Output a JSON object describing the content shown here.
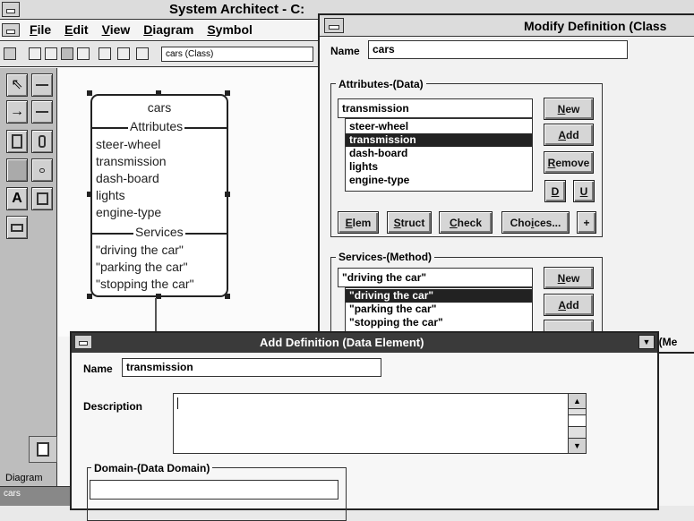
{
  "main_window": {
    "title": "System Architect - C:",
    "menu": [
      {
        "ul": "F",
        "rest": "ile"
      },
      {
        "ul": "E",
        "rest": "dit"
      },
      {
        "ul": "V",
        "rest": "iew"
      },
      {
        "ul": "D",
        "rest": "iagram"
      },
      {
        "ul": "S",
        "rest": "ymbol"
      }
    ],
    "toolbar_combo": "cars (Class)",
    "diagram_icon_label": "Diagram",
    "status_text": "cars"
  },
  "class_symbol": {
    "name": "cars",
    "attributes_header": "Attributes",
    "attributes": [
      "steer-wheel",
      "transmission",
      "dash-board",
      "lights",
      "engine-type"
    ],
    "services_header": "Services",
    "services": [
      "\"driving the car\"",
      "\"parking the car\"",
      "\"stopping the car\""
    ]
  },
  "modify_dialog": {
    "title": "Modify  Definition (Class",
    "name_label": "Name",
    "name_value": "cars",
    "attributes_group": "Attributes-(Data)",
    "attributes_input": "transmission",
    "attributes_list": [
      "steer-wheel",
      "transmission",
      "dash-board",
      "lights",
      "engine-type"
    ],
    "attributes_selected": 1,
    "btn_new": {
      "ul": "N",
      "rest": "ew"
    },
    "btn_add": {
      "ul": "A",
      "rest": "dd"
    },
    "btn_remove": {
      "ul": "R",
      "rest": "emove"
    },
    "btn_d": "D",
    "btn_u": "U",
    "btn_elem": {
      "ul": "E",
      "rest": "lem"
    },
    "btn_struct": {
      "ul": "S",
      "rest": "truct"
    },
    "btn_check": {
      "ul": "C",
      "rest": "heck"
    },
    "btn_choices_a": "Cho",
    "btn_choices_ul": "i",
    "btn_choices_b": "ces...",
    "btn_plus": "+",
    "services_group": "Services-(Method)",
    "services_input": "\"driving the car\"",
    "services_list": [
      "\"driving the car\"",
      "\"parking the car\"",
      "\"stopping the car\""
    ],
    "services_selected": 0,
    "services_new": {
      "ul": "N",
      "rest": "ew"
    },
    "services_add": {
      "ul": "A",
      "rest": "dd"
    },
    "obscured_text": "n (Me"
  },
  "add_dialog": {
    "title": "Add  Definition (Data Element)",
    "name_label": "Name",
    "name_value": "transmission",
    "description_label": "Description",
    "domain_group": "Domain-(Data Domain)"
  }
}
